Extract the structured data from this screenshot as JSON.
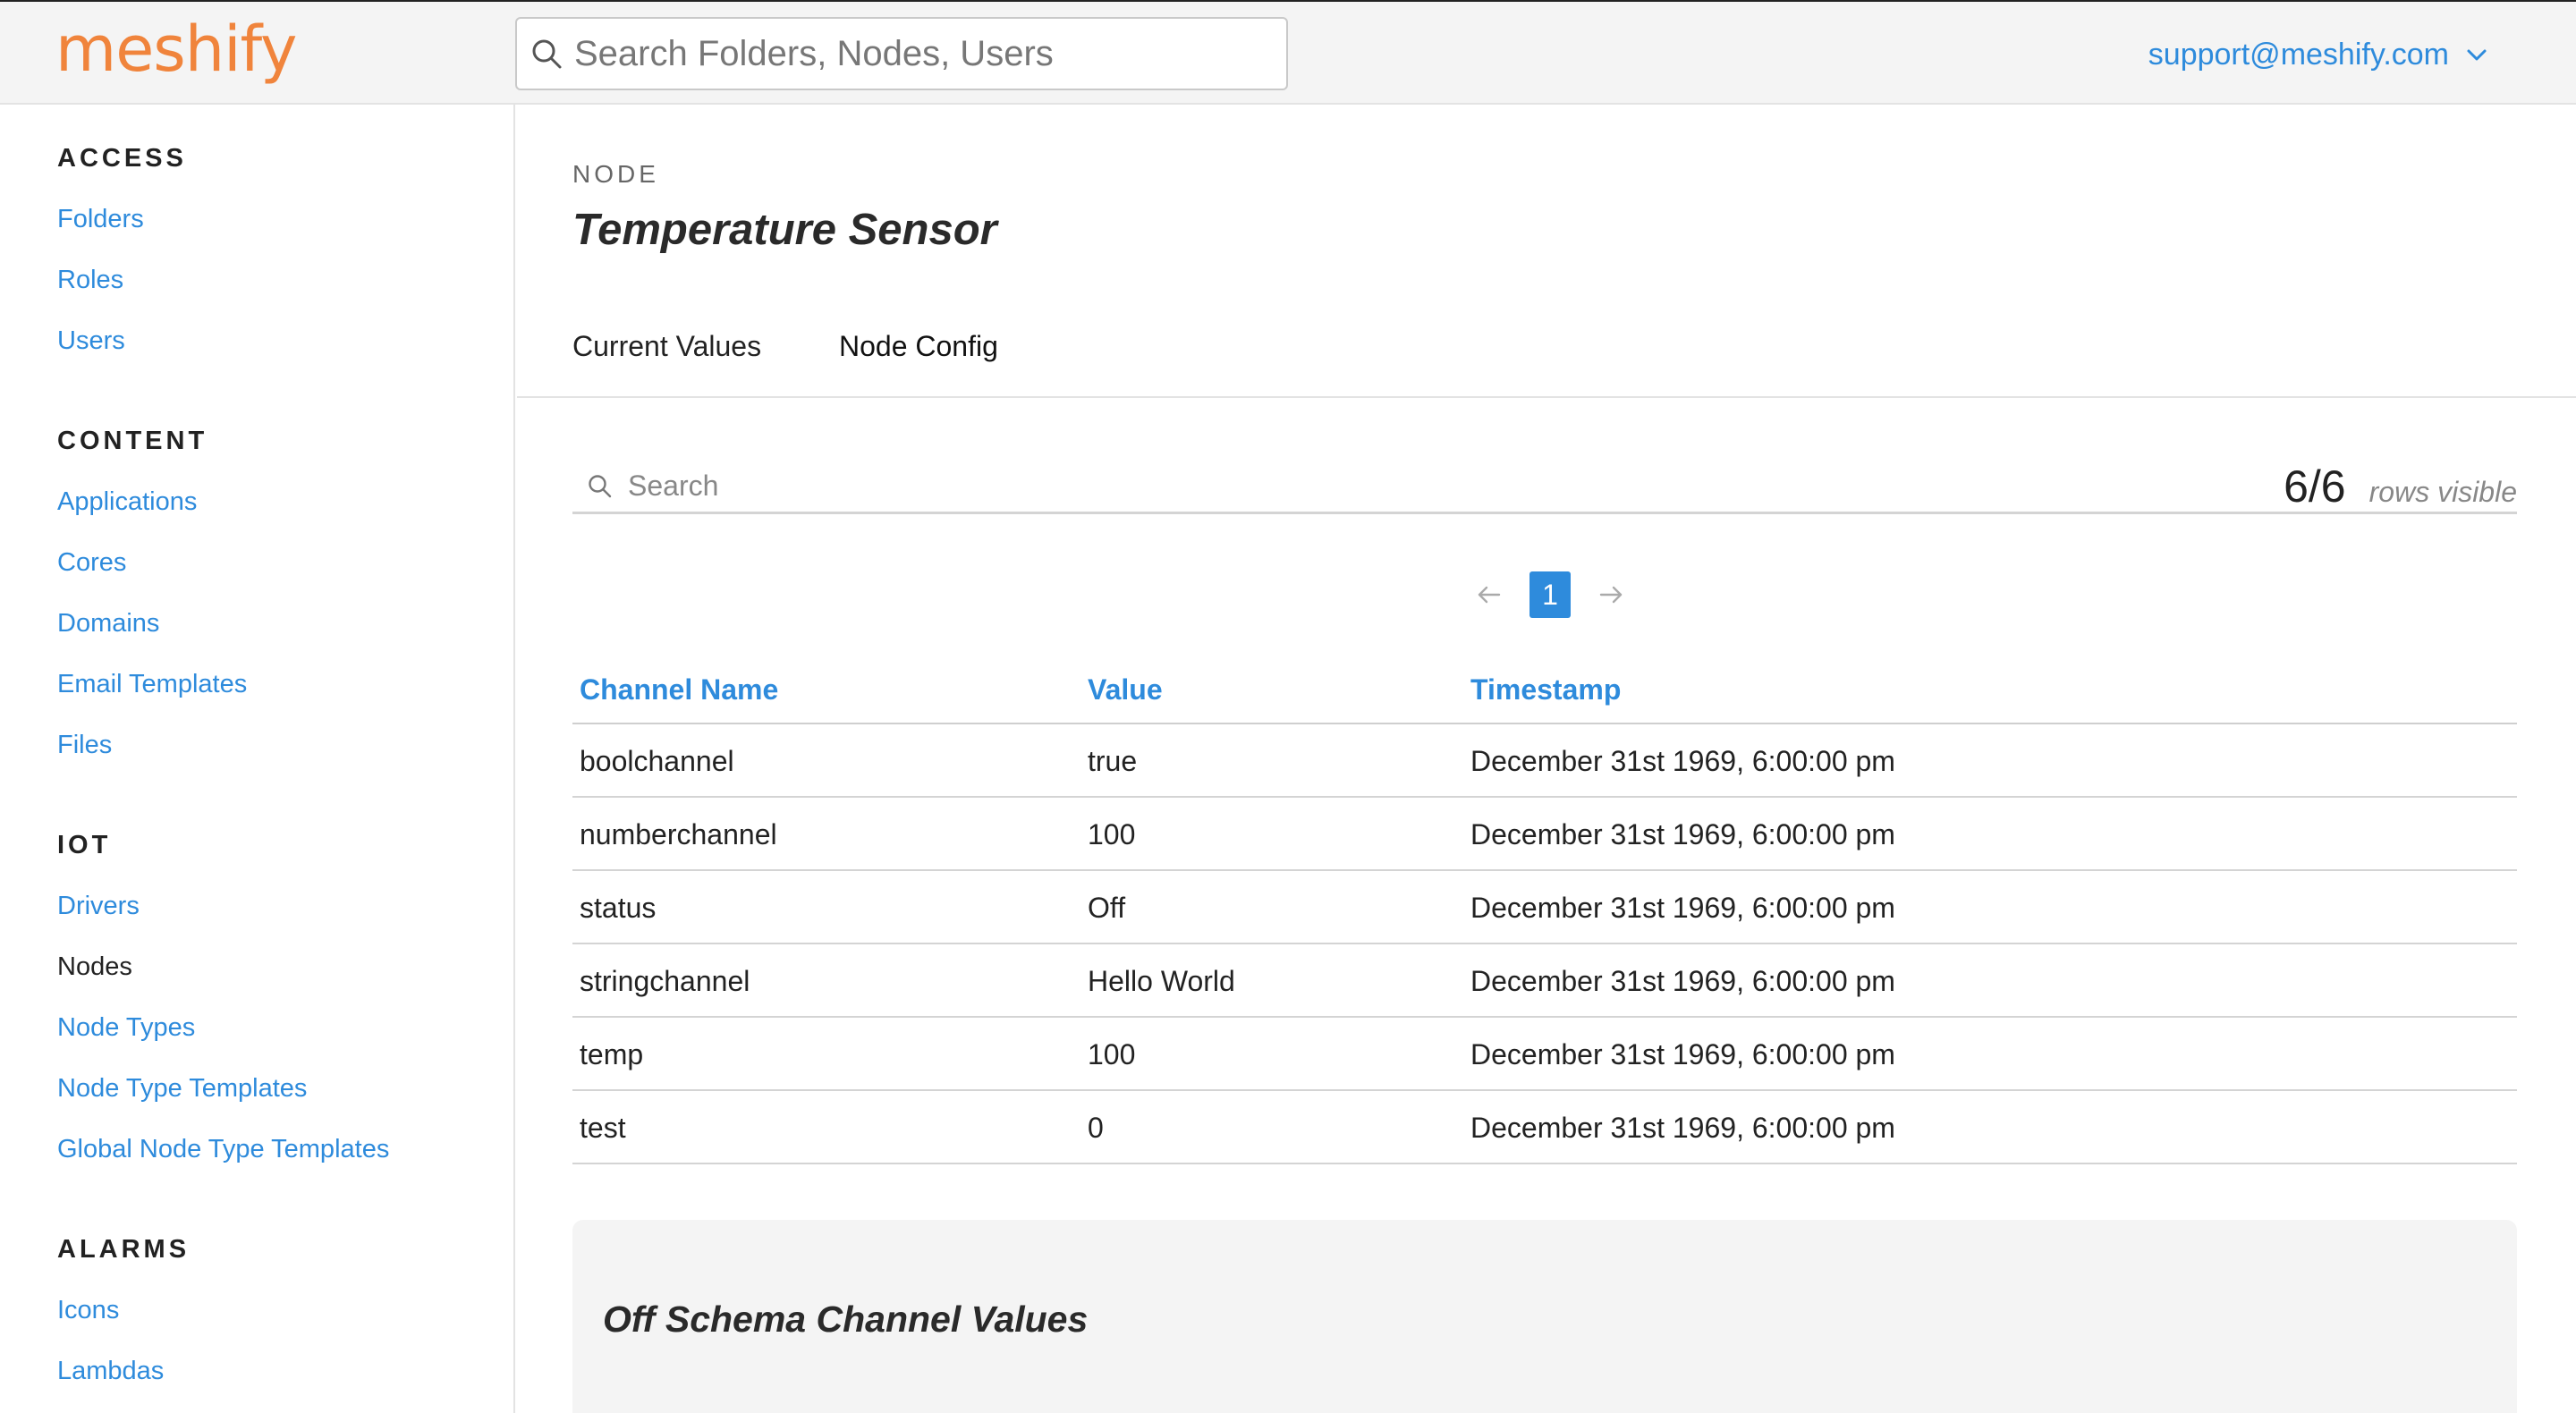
{
  "header": {
    "logo": "meshify",
    "search_placeholder": "Search Folders, Nodes, Users",
    "user_email": "support@meshify.com"
  },
  "sidebar": {
    "groups": [
      {
        "heading": "ACCESS",
        "items": [
          "Folders",
          "Roles",
          "Users"
        ]
      },
      {
        "heading": "CONTENT",
        "items": [
          "Applications",
          "Cores",
          "Domains",
          "Email Templates",
          "Files"
        ]
      },
      {
        "heading": "IOT",
        "items": [
          "Drivers",
          "Nodes",
          "Node Types",
          "Node Type Templates",
          "Global Node Type Templates"
        ]
      },
      {
        "heading": "ALARMS",
        "items": [
          "Icons",
          "Lambdas"
        ]
      }
    ],
    "active_item": "Nodes"
  },
  "main": {
    "node_label": "NODE",
    "node_title": "Temperature Sensor",
    "tabs": [
      {
        "label": "Current Values"
      },
      {
        "label": "Node Config"
      }
    ],
    "table_search_placeholder": "Search",
    "rows_count": "6/6",
    "rows_text": "rows visible",
    "pager": {
      "current_page": "1"
    },
    "columns": [
      "Channel Name",
      "Value",
      "Timestamp"
    ],
    "rows": [
      [
        "boolchannel",
        "true",
        "December 31st 1969, 6:00:00 pm"
      ],
      [
        "numberchannel",
        "100",
        "December 31st 1969, 6:00:00 pm"
      ],
      [
        "status",
        "Off",
        "December 31st 1969, 6:00:00 pm"
      ],
      [
        "stringchannel",
        "Hello World",
        "December 31st 1969, 6:00:00 pm"
      ],
      [
        "temp",
        "100",
        "December 31st 1969, 6:00:00 pm"
      ],
      [
        "test",
        "0",
        "December 31st 1969, 6:00:00 pm"
      ]
    ],
    "offschema_title": "Off Schema Channel Values"
  },
  "icons": {
    "search": "search-icon",
    "chevron": "chevron-down-icon",
    "prev": "arrow-left-icon",
    "next": "arrow-right-icon"
  },
  "colors": {
    "brand_orange": "#f0843c",
    "link_blue": "#2e8bdc",
    "header_bg": "#f4f4f4"
  }
}
